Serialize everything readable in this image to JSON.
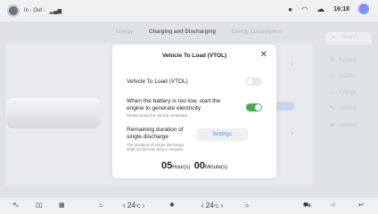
{
  "status": {
    "left_text": "In - Out -",
    "time": "16:18"
  },
  "tabs": [
    "Energy",
    "Charging and Discharging",
    "Energy Consumption"
  ],
  "sidebar": {
    "search_placeholder": "Search",
    "items": [
      "System",
      "ADAS",
      "Energy",
      "Vehicle",
      "Service"
    ]
  },
  "dialog": {
    "title": "Vehicle To Load (VTOL)",
    "vtol_label": "Vehicle To Load (VTOL)",
    "vtol_on": false,
    "engine_label": "When the battery is too low, start the engine to generate electricity",
    "engine_hint": "Please keep the vehicle ventilated",
    "engine_on": true,
    "duration_label": "Remaining duration of single discharge",
    "duration_hint": "The duration of single discharge shall not be less than 5 minutes.",
    "settings_label": "Settings",
    "hours": "05",
    "hours_unit": "Hour(s)",
    "minutes": "00",
    "minutes_unit": "Minute(s)"
  },
  "bottom": {
    "temp_left": "24",
    "temp_right": "24",
    "temp_unit": "°C"
  }
}
